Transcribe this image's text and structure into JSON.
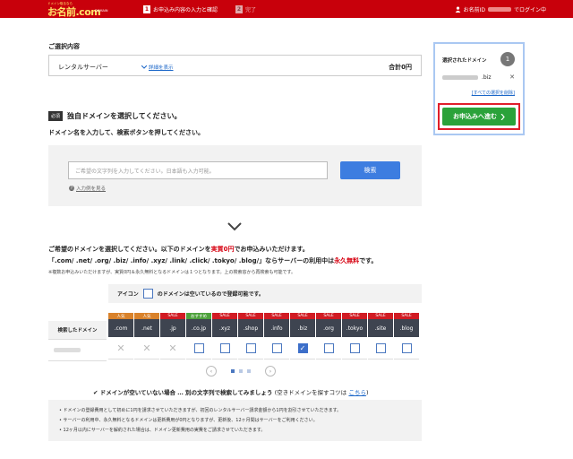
{
  "header": {
    "logo_tagline": "ドメイン取るなら",
    "logo_text": "お名前.com",
    "logo_domain": "DOMAIN",
    "step1_num": "1",
    "step1_label": "お申込み内容の入力と確認",
    "step2_num": "2",
    "step2_label": "完了",
    "user_prefix": "お名前ID",
    "user_suffix": "でログイン中"
  },
  "selection": {
    "title": "ご選択内容",
    "service": "レンタルサーバー",
    "detail_link": "詳細を表示",
    "total": "合計0円"
  },
  "side_panel": {
    "title": "選択されたドメイン",
    "count": "1",
    "domain_suffix": ".biz",
    "remove_all": "[すべての選択を削除]",
    "proceed": "お申込みへ進む"
  },
  "domain_section": {
    "required_badge": "必須",
    "title": "独自ドメインを選択してください。",
    "instruction": "ドメイン名を入力して、検索ボタンを押してください。",
    "search_placeholder": "ご希望の文字列を入力してください。日本語も入力可能。",
    "search_button": "検索",
    "example_link": "入力例を見る"
  },
  "promo": {
    "line1_a": "ご希望のドメインを選択してください。以下のドメインを",
    "line1_b": "実質0円",
    "line1_c": "でお申込みいただけます。",
    "line2_a": "「.com/ .net/ .org/ .biz/ .info/ .xyz/ .link/ .click/ .tokyo/ .blog/」ならサーバーの利用中は",
    "line2_b": "永久無料",
    "line2_c": "です。",
    "note": "※複数お申込みいただけますが、実質0円＆永久無料となるドメインは１つとなります。上の検索窓から再検索も可能です。"
  },
  "legend": {
    "prefix": "アイコン",
    "suffix": "のドメインは空いているので登録可能です。"
  },
  "table": {
    "label": "検索したドメイン",
    "columns": [
      {
        "tag": "人気",
        "tag_type": "pop",
        "tld": ".com",
        "state": "na"
      },
      {
        "tag": "人気",
        "tag_type": "pop",
        "tld": ".net",
        "state": "na"
      },
      {
        "tag": "SALE",
        "tag_type": "sale",
        "tld": ".jp",
        "state": "na"
      },
      {
        "tag": "おすすめ",
        "tag_type": "rec",
        "tld": ".co.jp",
        "state": "available"
      },
      {
        "tag": "SALE",
        "tag_type": "sale",
        "tld": ".xyz",
        "state": "available"
      },
      {
        "tag": "SALE",
        "tag_type": "sale",
        "tld": ".shop",
        "state": "available"
      },
      {
        "tag": "SALE",
        "tag_type": "sale",
        "tld": ".info",
        "state": "available"
      },
      {
        "tag": "SALE",
        "tag_type": "sale",
        "tld": ".biz",
        "state": "checked"
      },
      {
        "tag": "SALE",
        "tag_type": "sale",
        "tld": ".org",
        "state": "available"
      },
      {
        "tag": "SALE",
        "tag_type": "sale",
        "tld": ".tokyo",
        "state": "available"
      },
      {
        "tag": "SALE",
        "tag_type": "sale",
        "tld": ".site",
        "state": "available"
      },
      {
        "tag": "SALE",
        "tag_type": "sale",
        "tld": ".blog",
        "state": "available"
      }
    ]
  },
  "hint": {
    "main": "✔ ドメインが空いていない場合 … 別の文字列で検索してみましょう",
    "sub": "(空きドメインを探すコツは",
    "link": "こちら",
    "close": ")"
  },
  "notes": [
    "ドメインの登録費用として初めに1円を請求させていただきますが、初回のレンタルサーバー請求金額から1円を割引させていただきます。",
    "サーバーの利用中、永久無料となるドメインは更新費用が0円となりますが、更新後、12ヶ月間はサーバーをご利用ください。",
    "12ヶ月以内にサーバーを解約された場合は、ドメイン更新費用の実費をご請求させていただきます。"
  ]
}
